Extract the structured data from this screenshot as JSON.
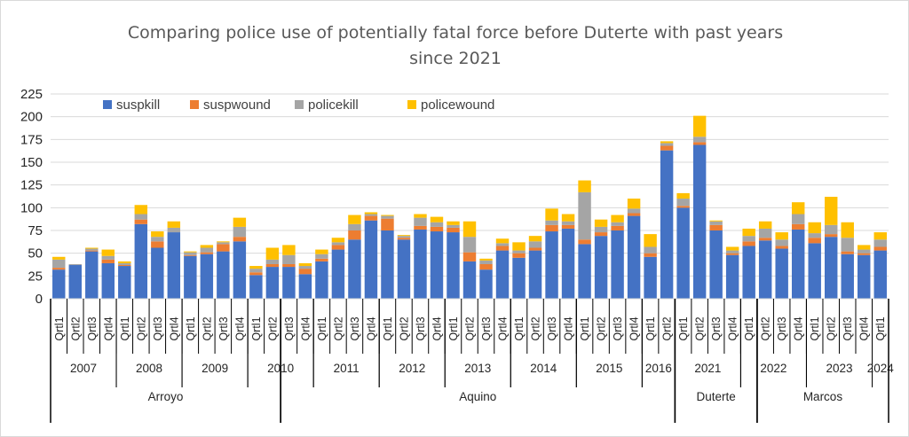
{
  "chart_data": {
    "type": "bar",
    "stacked": true,
    "title": "Comparing police use of potentially fatal force before Duterte with past years",
    "subtitle": "since 2021",
    "ylim": [
      0,
      225
    ],
    "yticks": [
      "0",
      "25",
      "50",
      "75",
      "100",
      "125",
      "150",
      "175",
      "200",
      "225"
    ],
    "grid": true,
    "legend_position": "top-left",
    "colors": {
      "suspkill": "#4472c4",
      "suspwound": "#ed7d31",
      "policekill": "#a5a5a5",
      "policewound": "#ffc000"
    },
    "series_names": [
      "suspkill",
      "suspwound",
      "policekill",
      "policewound"
    ],
    "categories": [
      {
        "q": "Qrtl1",
        "year": "2007",
        "period": "Arroyo",
        "suspkill": 32,
        "suspwound": 2,
        "policekill": 9,
        "policewound": 3
      },
      {
        "q": "Qrtl2",
        "year": "2007",
        "period": "Arroyo",
        "suspkill": 37,
        "suspwound": 0,
        "policekill": 1,
        "policewound": 0
      },
      {
        "q": "Qrtl3",
        "year": "2007",
        "period": "Arroyo",
        "suspkill": 52,
        "suspwound": 1,
        "policekill": 2,
        "policewound": 1
      },
      {
        "q": "Qrtl4",
        "year": "2007",
        "period": "Arroyo",
        "suspkill": 39,
        "suspwound": 4,
        "policekill": 4,
        "policewound": 7
      },
      {
        "q": "Qrtl1",
        "year": "2008",
        "period": "Arroyo",
        "suspkill": 36,
        "suspwound": 1,
        "policekill": 2,
        "policewound": 2
      },
      {
        "q": "Qrtl2",
        "year": "2008",
        "period": "Arroyo",
        "suspkill": 82,
        "suspwound": 5,
        "policekill": 6,
        "policewound": 10
      },
      {
        "q": "Qrtl3",
        "year": "2008",
        "period": "Arroyo",
        "suspkill": 56,
        "suspwound": 7,
        "policekill": 5,
        "policewound": 6
      },
      {
        "q": "Qrtl4",
        "year": "2008",
        "period": "Arroyo",
        "suspkill": 73,
        "suspwound": 0,
        "policekill": 5,
        "policewound": 7
      },
      {
        "q": "Qrtl1",
        "year": "2009",
        "period": "Arroyo",
        "suspkill": 47,
        "suspwound": 1,
        "policekill": 3,
        "policewound": 1
      },
      {
        "q": "Qrtl2",
        "year": "2009",
        "period": "Arroyo",
        "suspkill": 49,
        "suspwound": 2,
        "policekill": 5,
        "policewound": 3
      },
      {
        "q": "Qrtl3",
        "year": "2009",
        "period": "Arroyo",
        "suspkill": 52,
        "suspwound": 8,
        "policekill": 2,
        "policewound": 1
      },
      {
        "q": "Qrtl4",
        "year": "2009",
        "period": "Arroyo",
        "suspkill": 63,
        "suspwound": 5,
        "policekill": 11,
        "policewound": 10
      },
      {
        "q": "Qrtl1",
        "year": "2010",
        "period": "Arroyo",
        "suspkill": 26,
        "suspwound": 3,
        "policekill": 4,
        "policewound": 3
      },
      {
        "q": "Qrtl2",
        "year": "2010",
        "period": "Arroyo",
        "suspkill": 35,
        "suspwound": 3,
        "policekill": 5,
        "policewound": 13
      },
      {
        "q": "Qrtl3",
        "year": "2010",
        "period": "Aquino",
        "suspkill": 35,
        "suspwound": 3,
        "policekill": 10,
        "policewound": 11
      },
      {
        "q": "Qrtl4",
        "year": "2010",
        "period": "Aquino",
        "suspkill": 27,
        "suspwound": 6,
        "policekill": 3,
        "policewound": 3
      },
      {
        "q": "Qrtl1",
        "year": "2011",
        "period": "Aquino",
        "suspkill": 41,
        "suspwound": 3,
        "policekill": 5,
        "policewound": 5
      },
      {
        "q": "Qrtl2",
        "year": "2011",
        "period": "Aquino",
        "suspkill": 54,
        "suspwound": 5,
        "policekill": 3,
        "policewound": 5
      },
      {
        "q": "Qrtl3",
        "year": "2011",
        "period": "Aquino",
        "suspkill": 65,
        "suspwound": 10,
        "policekill": 7,
        "policewound": 10
      },
      {
        "q": "Qrtl4",
        "year": "2011",
        "period": "Aquino",
        "suspkill": 86,
        "suspwound": 5,
        "policekill": 2,
        "policewound": 2
      },
      {
        "q": "Qrtl1",
        "year": "2012",
        "period": "Aquino",
        "suspkill": 75,
        "suspwound": 13,
        "policekill": 3,
        "policewound": 1
      },
      {
        "q": "Qrtl2",
        "year": "2012",
        "period": "Aquino",
        "suspkill": 65,
        "suspwound": 2,
        "policekill": 2,
        "policewound": 1
      },
      {
        "q": "Qrtl3",
        "year": "2012",
        "period": "Aquino",
        "suspkill": 76,
        "suspwound": 4,
        "policekill": 9,
        "policewound": 4
      },
      {
        "q": "Qrtl4",
        "year": "2012",
        "period": "Aquino",
        "suspkill": 74,
        "suspwound": 5,
        "policekill": 5,
        "policewound": 6
      },
      {
        "q": "Qrtl1",
        "year": "2013",
        "period": "Aquino",
        "suspkill": 73,
        "suspwound": 5,
        "policekill": 3,
        "policewound": 4
      },
      {
        "q": "Qrtl2",
        "year": "2013",
        "period": "Aquino",
        "suspkill": 41,
        "suspwound": 10,
        "policekill": 17,
        "policewound": 17
      },
      {
        "q": "Qrtl3",
        "year": "2013",
        "period": "Aquino",
        "suspkill": 32,
        "suspwound": 6,
        "policekill": 4,
        "policewound": 2
      },
      {
        "q": "Qrtl4",
        "year": "2013",
        "period": "Aquino",
        "suspkill": 53,
        "suspwound": 5,
        "policekill": 3,
        "policewound": 5
      },
      {
        "q": "Qrtl1",
        "year": "2014",
        "period": "Aquino",
        "suspkill": 45,
        "suspwound": 5,
        "policekill": 3,
        "policewound": 9
      },
      {
        "q": "Qrtl2",
        "year": "2014",
        "period": "Aquino",
        "suspkill": 53,
        "suspwound": 3,
        "policekill": 7,
        "policewound": 6
      },
      {
        "q": "Qrtl3",
        "year": "2014",
        "period": "Aquino",
        "suspkill": 74,
        "suspwound": 7,
        "policekill": 5,
        "policewound": 13
      },
      {
        "q": "Qrtl4",
        "year": "2014",
        "period": "Aquino",
        "suspkill": 77,
        "suspwound": 4,
        "policekill": 4,
        "policewound": 8
      },
      {
        "q": "Qrtl1",
        "year": "2015",
        "period": "Aquino",
        "suspkill": 60,
        "suspwound": 5,
        "policekill": 52,
        "policewound": 13
      },
      {
        "q": "Qrtl2",
        "year": "2015",
        "period": "Aquino",
        "suspkill": 69,
        "suspwound": 4,
        "policekill": 6,
        "policewound": 8
      },
      {
        "q": "Qrtl3",
        "year": "2015",
        "period": "Aquino",
        "suspkill": 75,
        "suspwound": 5,
        "policekill": 4,
        "policewound": 8
      },
      {
        "q": "Qrtl4",
        "year": "2015",
        "period": "Aquino",
        "suspkill": 91,
        "suspwound": 3,
        "policekill": 5,
        "policewound": 11
      },
      {
        "q": "Qrtl1",
        "year": "2016",
        "period": "Aquino",
        "suspkill": 46,
        "suspwound": 4,
        "policekill": 7,
        "policewound": 14
      },
      {
        "q": "Qrtl2",
        "year": "2016",
        "period": "Aquino",
        "suspkill": 163,
        "suspwound": 5,
        "policekill": 3,
        "policewound": 2
      },
      {
        "q": "Qrtl1",
        "year": "2021",
        "period": "Duterte",
        "suspkill": 100,
        "suspwound": 2,
        "policekill": 8,
        "policewound": 6
      },
      {
        "q": "Qrtl2",
        "year": "2021",
        "period": "Duterte",
        "suspkill": 169,
        "suspwound": 3,
        "policekill": 6,
        "policewound": 23
      },
      {
        "q": "Qrtl3",
        "year": "2021",
        "period": "Duterte",
        "suspkill": 75,
        "suspwound": 6,
        "policekill": 4,
        "policewound": 1
      },
      {
        "q": "Qrtl4",
        "year": "2021",
        "period": "Duterte",
        "suspkill": 48,
        "suspwound": 2,
        "policekill": 3,
        "policewound": 4
      },
      {
        "q": "Qrtl1",
        "year": "2022",
        "period": "Duterte",
        "suspkill": 58,
        "suspwound": 5,
        "policekill": 6,
        "policewound": 8
      },
      {
        "q": "Qrtl2",
        "year": "2022",
        "period": "Marcos",
        "suspkill": 64,
        "suspwound": 3,
        "policekill": 10,
        "policewound": 8
      },
      {
        "q": "Qrtl3",
        "year": "2022",
        "period": "Marcos",
        "suspkill": 55,
        "suspwound": 3,
        "policekill": 7,
        "policewound": 8
      },
      {
        "q": "Qrtl4",
        "year": "2022",
        "period": "Marcos",
        "suspkill": 76,
        "suspwound": 6,
        "policekill": 11,
        "policewound": 13
      },
      {
        "q": "Qrtl1",
        "year": "2023",
        "period": "Marcos",
        "suspkill": 61,
        "suspwound": 6,
        "policekill": 5,
        "policewound": 12
      },
      {
        "q": "Qrtl2",
        "year": "2023",
        "period": "Marcos",
        "suspkill": 68,
        "suspwound": 3,
        "policekill": 10,
        "policewound": 31
      },
      {
        "q": "Qrtl3",
        "year": "2023",
        "period": "Marcos",
        "suspkill": 49,
        "suspwound": 3,
        "policekill": 15,
        "policewound": 17
      },
      {
        "q": "Qrtl4",
        "year": "2023",
        "period": "Marcos",
        "suspkill": 48,
        "suspwound": 2,
        "policekill": 4,
        "policewound": 5
      },
      {
        "q": "Qrtl1",
        "year": "2024",
        "period": "Marcos",
        "suspkill": 53,
        "suspwound": 4,
        "policekill": 8,
        "policewound": 8
      }
    ]
  }
}
